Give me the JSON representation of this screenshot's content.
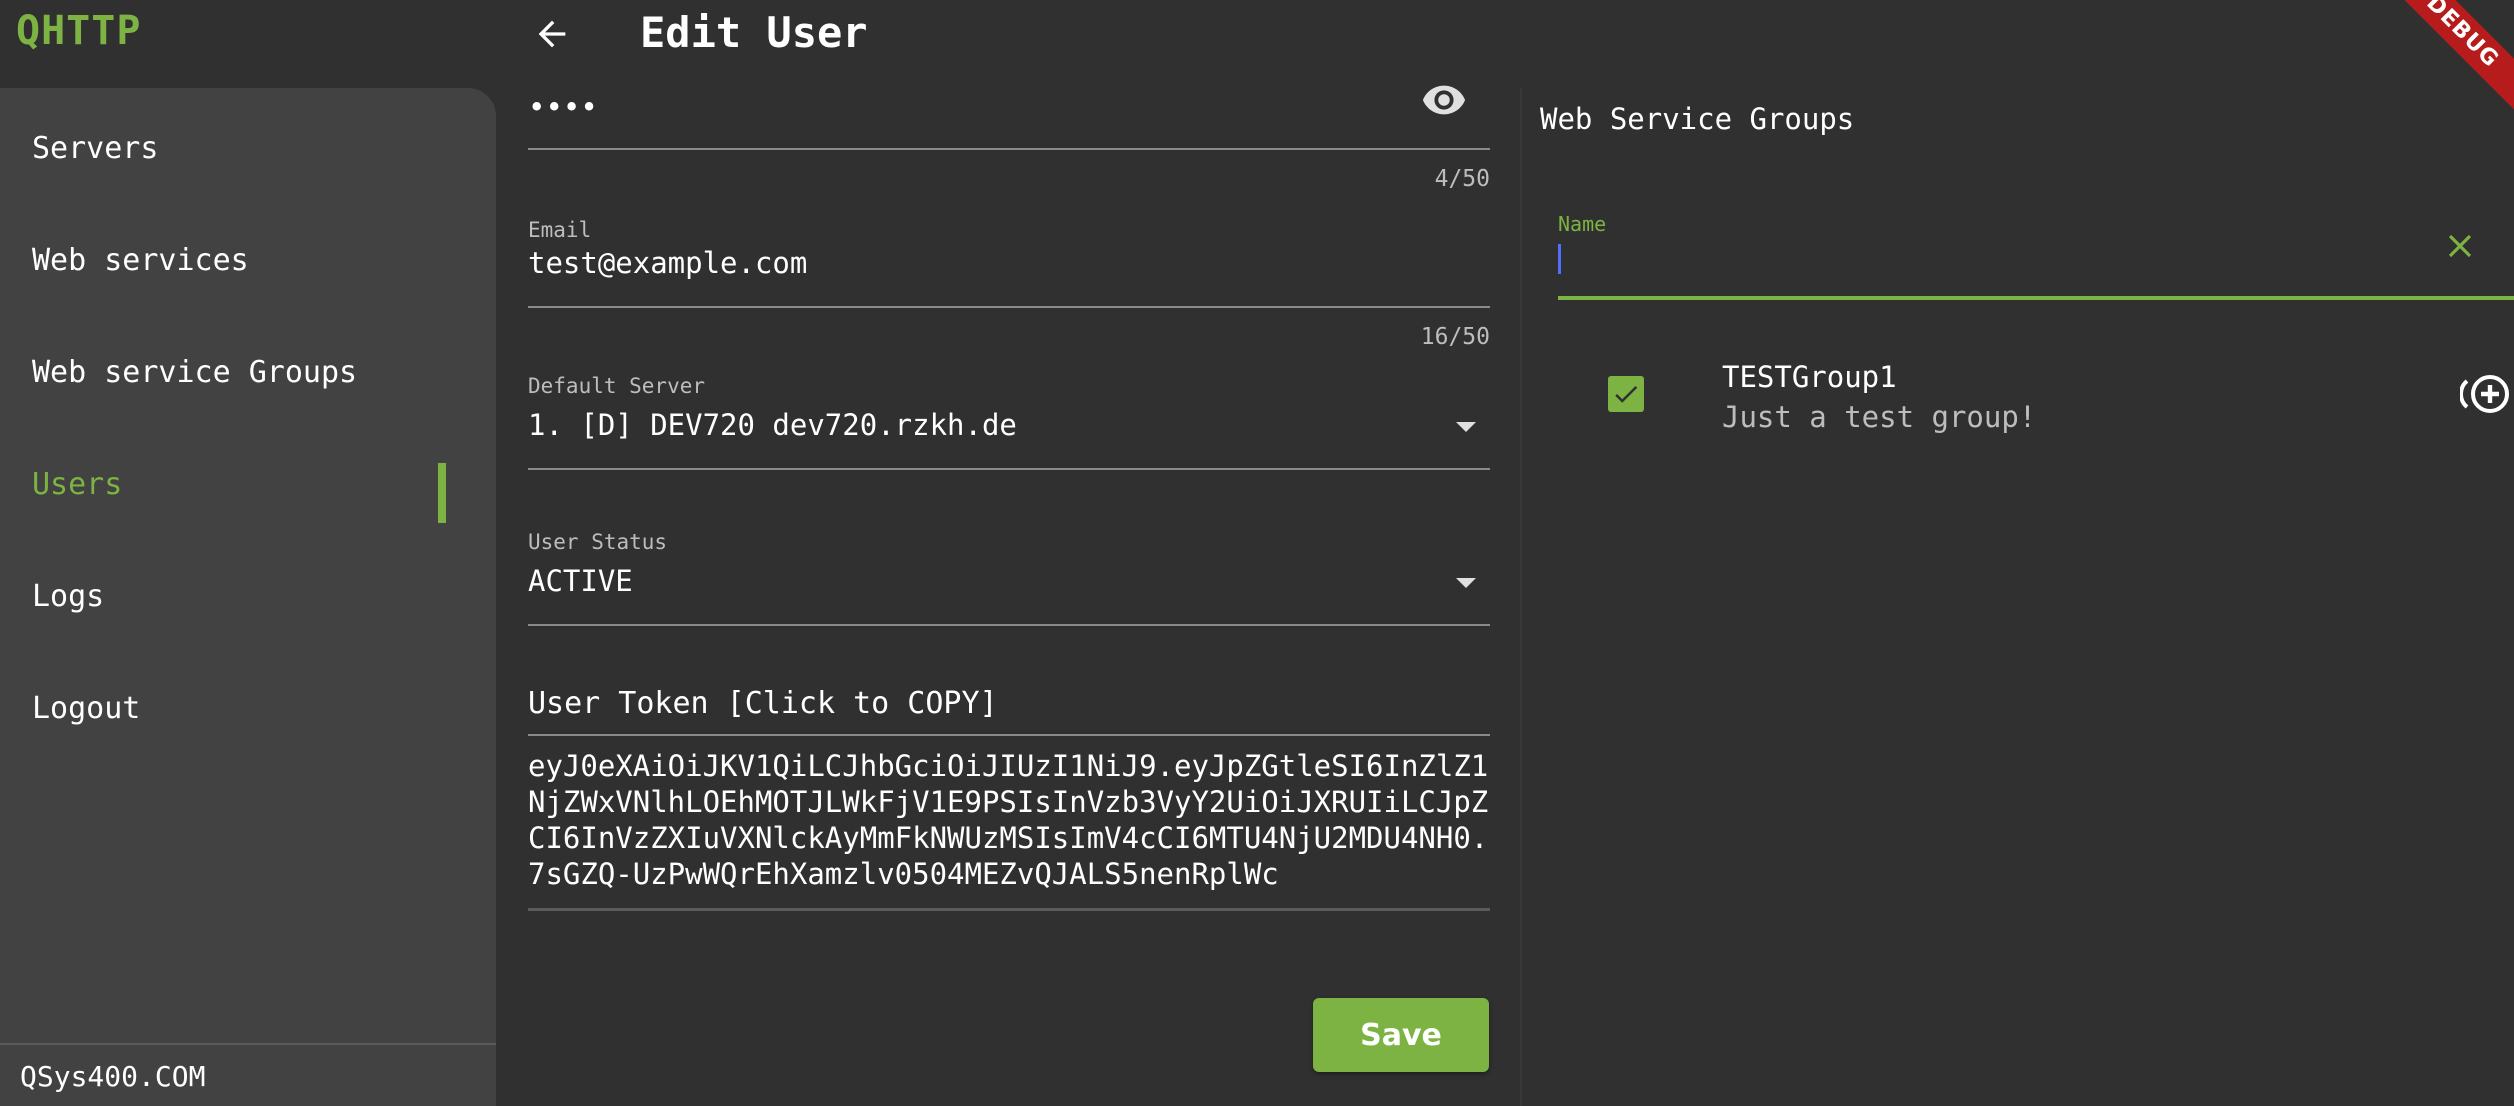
{
  "app": {
    "brand": "QHTTP",
    "page_title": "Edit User",
    "debug_banner": "DEBUG"
  },
  "sidebar": {
    "items": [
      {
        "label": "Servers",
        "active": false
      },
      {
        "label": "Web services",
        "active": false
      },
      {
        "label": "Web service Groups",
        "active": false
      },
      {
        "label": "Users",
        "active": true
      },
      {
        "label": "Logs",
        "active": false
      },
      {
        "label": "Logout",
        "active": false
      }
    ],
    "footer": "QSys400.COM"
  },
  "form": {
    "password": {
      "value": "••••",
      "counter": "4/50"
    },
    "email": {
      "label": "Email",
      "value": "test@example.com",
      "counter": "16/50"
    },
    "default_server": {
      "label": "Default Server",
      "value": "1. [D] DEV720 dev720.rzkh.de"
    },
    "user_status": {
      "label": "User Status",
      "value": "ACTIVE"
    },
    "token": {
      "heading": "User Token [Click to COPY]",
      "value": "eyJ0eXAiOiJKV1QiLCJhbGciOiJIUzI1NiJ9.eyJpZGtleSI6InZlZ1NjZWxVNlhLOEhMOTJLWkFjV1E9PSIsInVzb3VyY2UiOiJXRUIiLCJpZCI6InVzZXIuVXNlckAyMmFkNWUzMSIsImV4cCI6MTU4NjU2MDU4NH0.7sGZQ-UzPwWQrEhXamzlv0504MEZvQJALS5nenRplWc"
    },
    "save_label": "Save"
  },
  "groups_panel": {
    "title": "Web Service Groups",
    "filter": {
      "label": "Name",
      "value": ""
    },
    "groups": [
      {
        "name": "TESTGroup1",
        "description": "Just a test group!",
        "checked": true
      }
    ]
  },
  "colors": {
    "accent": "#7cb342",
    "background": "#303030",
    "sidebar": "#424242",
    "caret": "#536dfe"
  }
}
